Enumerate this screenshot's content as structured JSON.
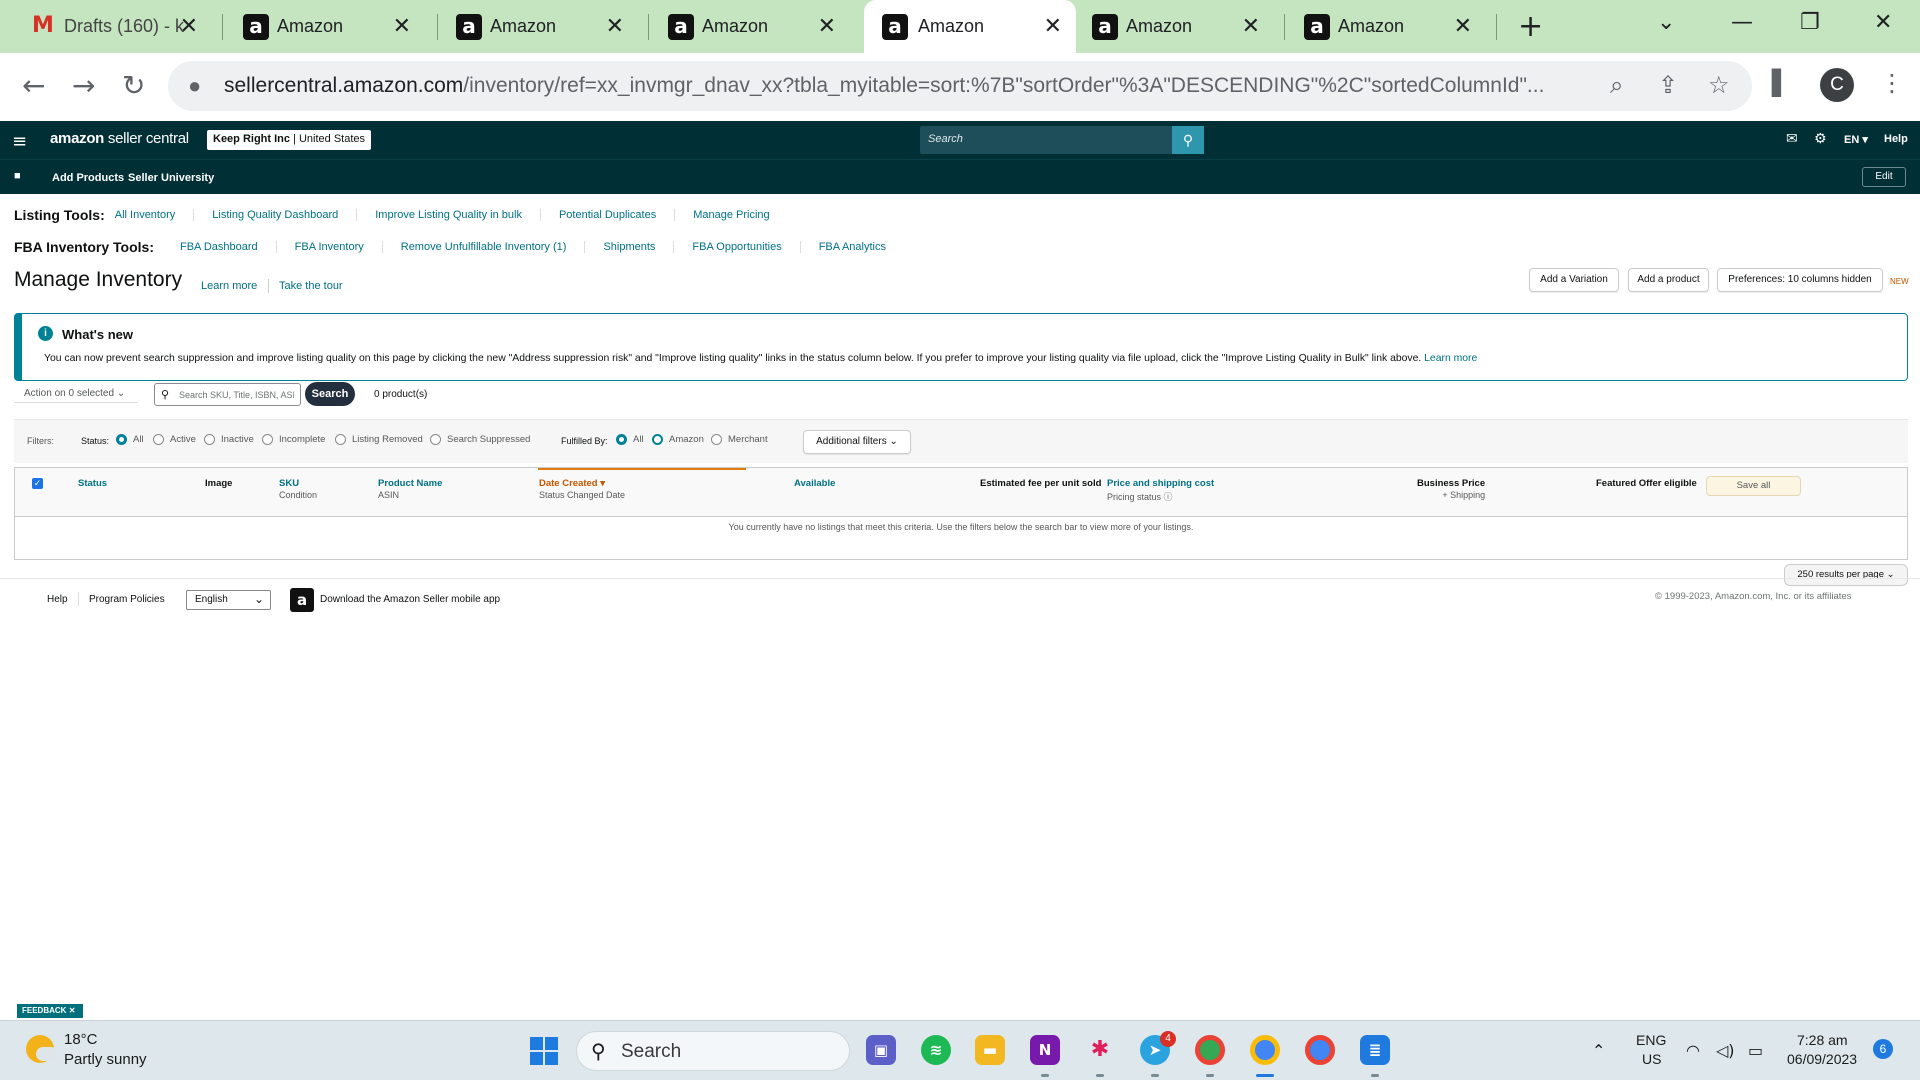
{
  "browser": {
    "tabs": [
      {
        "title": "Drafts (160) - k",
        "favicon": "gmail-icon",
        "active": false
      },
      {
        "title": "Amazon",
        "favicon": "amazon-icon",
        "active": false
      },
      {
        "title": "Amazon",
        "favicon": "amazon-icon",
        "active": false
      },
      {
        "title": "Amazon",
        "favicon": "amazon-icon",
        "active": false
      },
      {
        "title": "Amazon",
        "favicon": "amazon-icon",
        "active": true
      },
      {
        "title": "Amazon",
        "favicon": "amazon-icon",
        "active": false
      },
      {
        "title": "Amazon",
        "favicon": "amazon-icon",
        "active": false
      }
    ],
    "url_domain": "sellercentral.amazon.com",
    "url_path": "/inventory/ref=xx_invmgr_dnav_xx?tbla_myitable=sort:%7B\"sortOrder\"%3A\"DESCENDING\"%2C\"sortedColumnId\"...",
    "profile_initial": "C",
    "tab_strip_color": "#c5e5c0"
  },
  "header": {
    "logo_bold": "amazon",
    "logo_rest": " seller central",
    "store_name": "Keep Right Inc",
    "store_region": " | United States",
    "search_placeholder": "Search",
    "language": "EN",
    "help": "Help",
    "bg_color": "#002f36"
  },
  "nav": {
    "links": [
      "Add Products",
      "Seller University"
    ],
    "edit": "Edit"
  },
  "listing_tools": {
    "label": "Listing Tools:",
    "links": [
      "All Inventory",
      "Listing Quality Dashboard",
      "Improve Listing Quality in bulk",
      "Potential Duplicates",
      "Manage Pricing"
    ]
  },
  "fba_tools": {
    "label": "FBA Inventory Tools:",
    "links": [
      "FBA Dashboard",
      "FBA Inventory",
      "Remove Unfulfillable Inventory (1)",
      "Shipments",
      "FBA Opportunities",
      "FBA Analytics"
    ]
  },
  "page": {
    "title": "Manage Inventory",
    "learn_more": "Learn more",
    "take_tour": "Take the tour",
    "buttons": [
      "Add a Variation",
      "Add a product",
      "Preferences: 10 columns hidden"
    ],
    "new_tag": "NEW"
  },
  "banner": {
    "title": "What's new",
    "body": "You can now prevent search suppression and improve listing quality on this page by clicking the new \"Address suppression risk\" and \"Improve listing quality\" links in the status column below. If you prefer to improve your listing quality via file upload, click the \"Improve Listing Quality in Bulk\" link above.",
    "link": "Learn more",
    "accent": "#008296"
  },
  "toolbar": {
    "action": "Action on 0 selected",
    "search_placeholder": "Search SKU, Title, ISBN, ASIN",
    "search_button": "Search",
    "count": "0 product(s)"
  },
  "filters": {
    "label": "Filters:",
    "status_label": "Status:",
    "status_options": [
      "All",
      "Active",
      "Inactive",
      "Incomplete",
      "Listing Removed",
      "Search Suppressed"
    ],
    "status_selected": "All",
    "fulfilled_label": "Fulfilled By:",
    "fulfilled_options": [
      "All",
      "Amazon",
      "Merchant"
    ],
    "fulfilled_selected": "All",
    "additional": "Additional filters"
  },
  "table": {
    "columns": [
      {
        "label": "Status",
        "sub": ""
      },
      {
        "label": "Image",
        "sub": ""
      },
      {
        "label": "SKU",
        "sub": "Condition"
      },
      {
        "label": "Product Name",
        "sub": "ASIN"
      },
      {
        "label": "Date Created",
        "sub": "Status Changed Date",
        "sorted": "descending"
      },
      {
        "label": "Available",
        "sub": ""
      },
      {
        "label": "Estimated fee per unit sold",
        "sub": ""
      },
      {
        "label": "Price and shipping cost",
        "sub": "Pricing status"
      },
      {
        "label": "Business Price",
        "sub": "+ Shipping"
      },
      {
        "label": "Featured Offer eligible",
        "sub": ""
      }
    ],
    "save_all": "Save all",
    "empty_message": "You currently have no listings that meet this criteria. Use the filters below the search bar to view more of your listings.",
    "per_page": "250 results per page"
  },
  "footer": {
    "help": "Help",
    "policies": "Program Policies",
    "language": "English",
    "app": "Download the Amazon Seller mobile app",
    "copyright": "© 1999-2023, Amazon.com, Inc. or its affiliates",
    "feedback": "FEEDBACK"
  },
  "taskbar": {
    "temp": "18°C",
    "weather": "Partly sunny",
    "search": "Search",
    "lang": "ENG",
    "region": "US",
    "time": "7:28 am",
    "date": "06/09/2023",
    "notifications": "6",
    "telegram_badge": "4"
  }
}
